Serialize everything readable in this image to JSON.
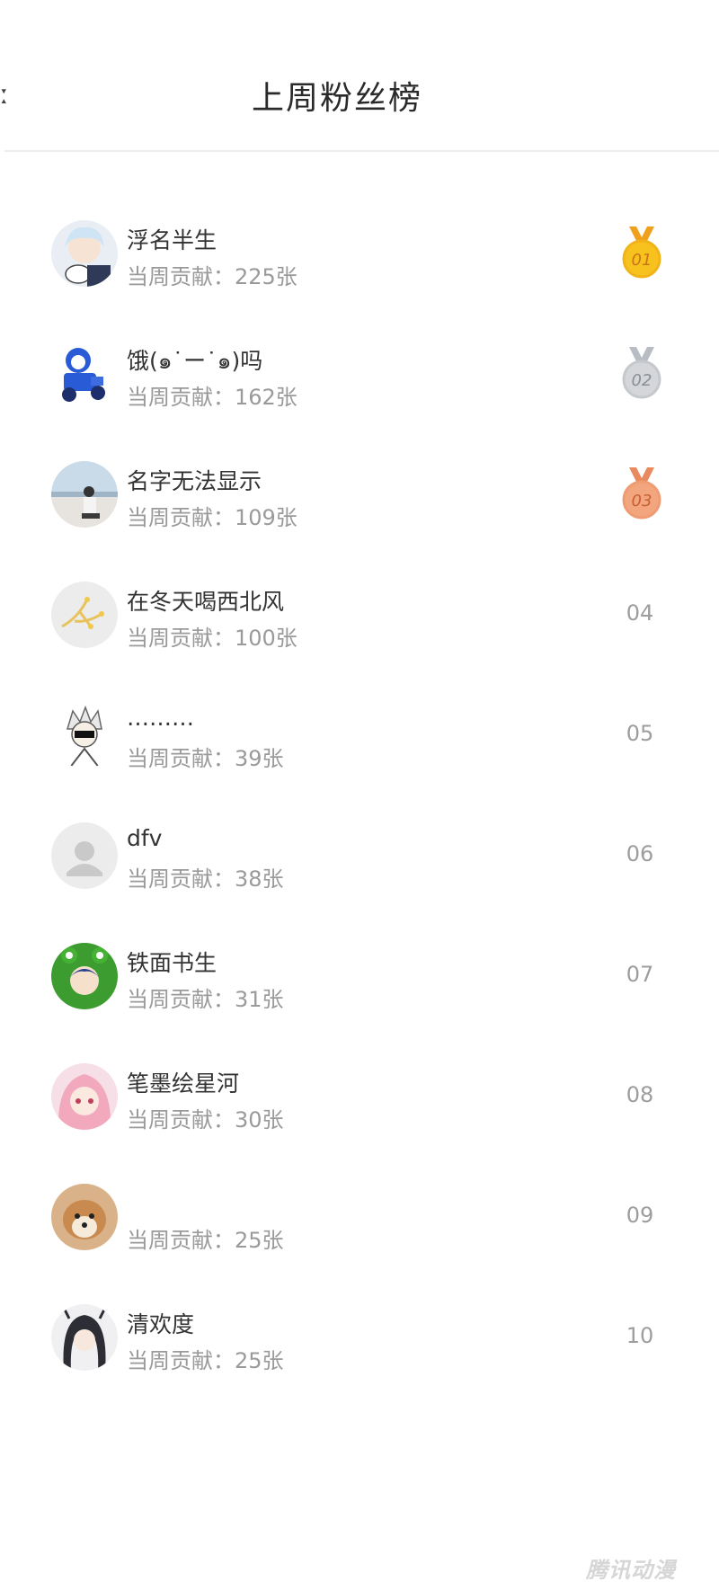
{
  "header": {
    "back_glyph": "ː",
    "title": "上周粉丝榜"
  },
  "rank_colors": {
    "gold": "#f7c21d",
    "silver": "#d4d6da",
    "bronze": "#f3a67e"
  },
  "fans": [
    {
      "rank": "01",
      "name": "浮名半生",
      "contribution": "当周贡献：225张",
      "medal": "gold",
      "avatar": "anime-white-hair-avatar"
    },
    {
      "rank": "02",
      "name": "饿(๑˙ー˙๑)吗",
      "contribution": "当周贡献：162张",
      "medal": "silver",
      "avatar": "blue-bear-rider-avatar"
    },
    {
      "rank": "03",
      "name": "名字无法显示",
      "contribution": "当周贡献：109张",
      "medal": "bronze",
      "avatar": "seaside-photo-avatar"
    },
    {
      "rank": "04",
      "name": "在冬天喝西北风",
      "contribution": "当周贡献：100张",
      "medal": "",
      "avatar": "gold-branch-avatar"
    },
    {
      "rank": "05",
      "name": "………",
      "contribution": "当周贡献：39张",
      "medal": "",
      "avatar": "sketch-character-avatar"
    },
    {
      "rank": "06",
      "name": "dfv",
      "contribution": "当周贡献：38张",
      "medal": "",
      "avatar": "default-user-avatar"
    },
    {
      "rank": "07",
      "name": "铁面书生",
      "contribution": "当周贡献：31张",
      "medal": "",
      "avatar": "frog-hood-avatar"
    },
    {
      "rank": "08",
      "name": "笔墨绘星河",
      "contribution": "当周贡献：30张",
      "medal": "",
      "avatar": "pink-hair-girl-avatar"
    },
    {
      "rank": "09",
      "name": "",
      "contribution": "当周贡献：25张",
      "medal": "",
      "avatar": "shiba-dog-avatar"
    },
    {
      "rank": "10",
      "name": "清欢度",
      "contribution": "当周贡献：25张",
      "medal": "",
      "avatar": "anime-dark-hair-avatar"
    }
  ],
  "watermark": "腾讯动漫"
}
